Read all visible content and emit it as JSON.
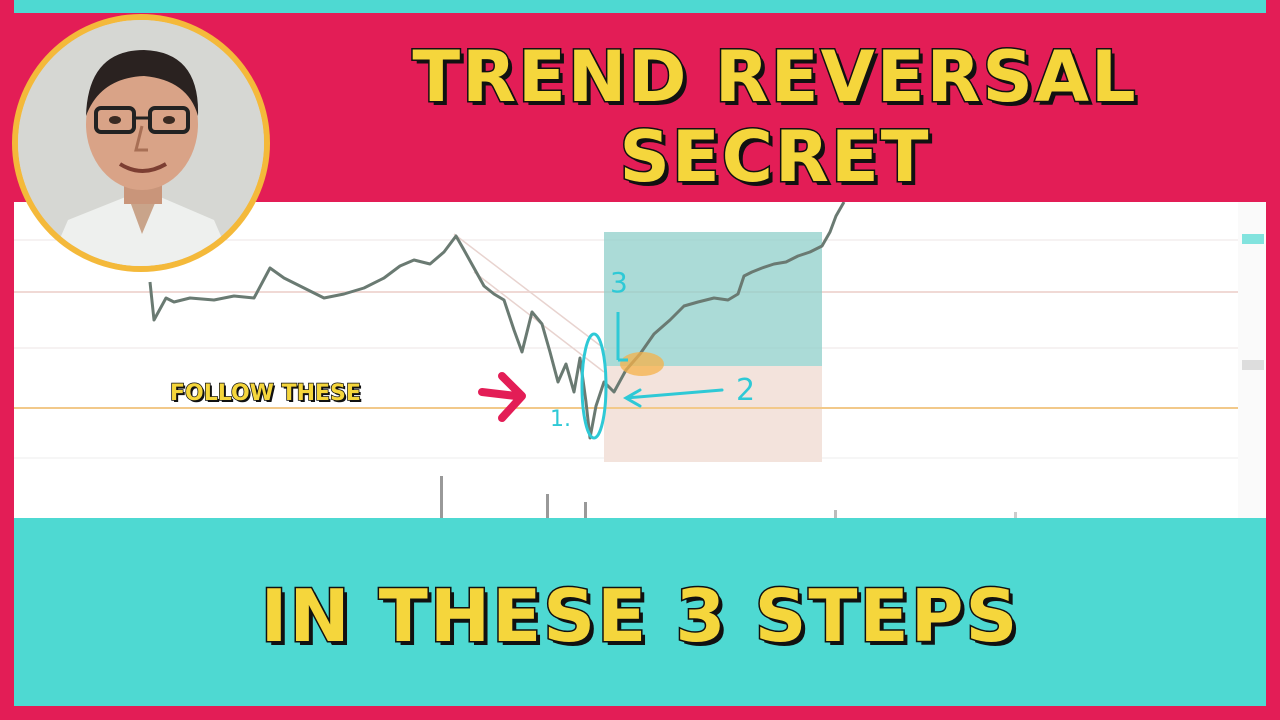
{
  "title": {
    "line1": "TREND REVERSAL",
    "line2": "SECRET"
  },
  "subtitle": "IN THESE 3 STEPS",
  "chart_overlay": {
    "follow_label": "FOLLOW THESE",
    "step_1": "1.",
    "step_2": "2",
    "step_3": "3"
  },
  "colors": {
    "background": "#e31d56",
    "band": "#4ed9d2",
    "title_text": "#f5d63c",
    "annotation_cyan": "#2ec9d6",
    "arrow_red": "#e31d56",
    "target_zone": "#8fcfc9",
    "stop_zone": "#f3e3dc"
  },
  "icons": {
    "avatar": "presenter-photo",
    "arrow": "arrow-right-icon"
  }
}
